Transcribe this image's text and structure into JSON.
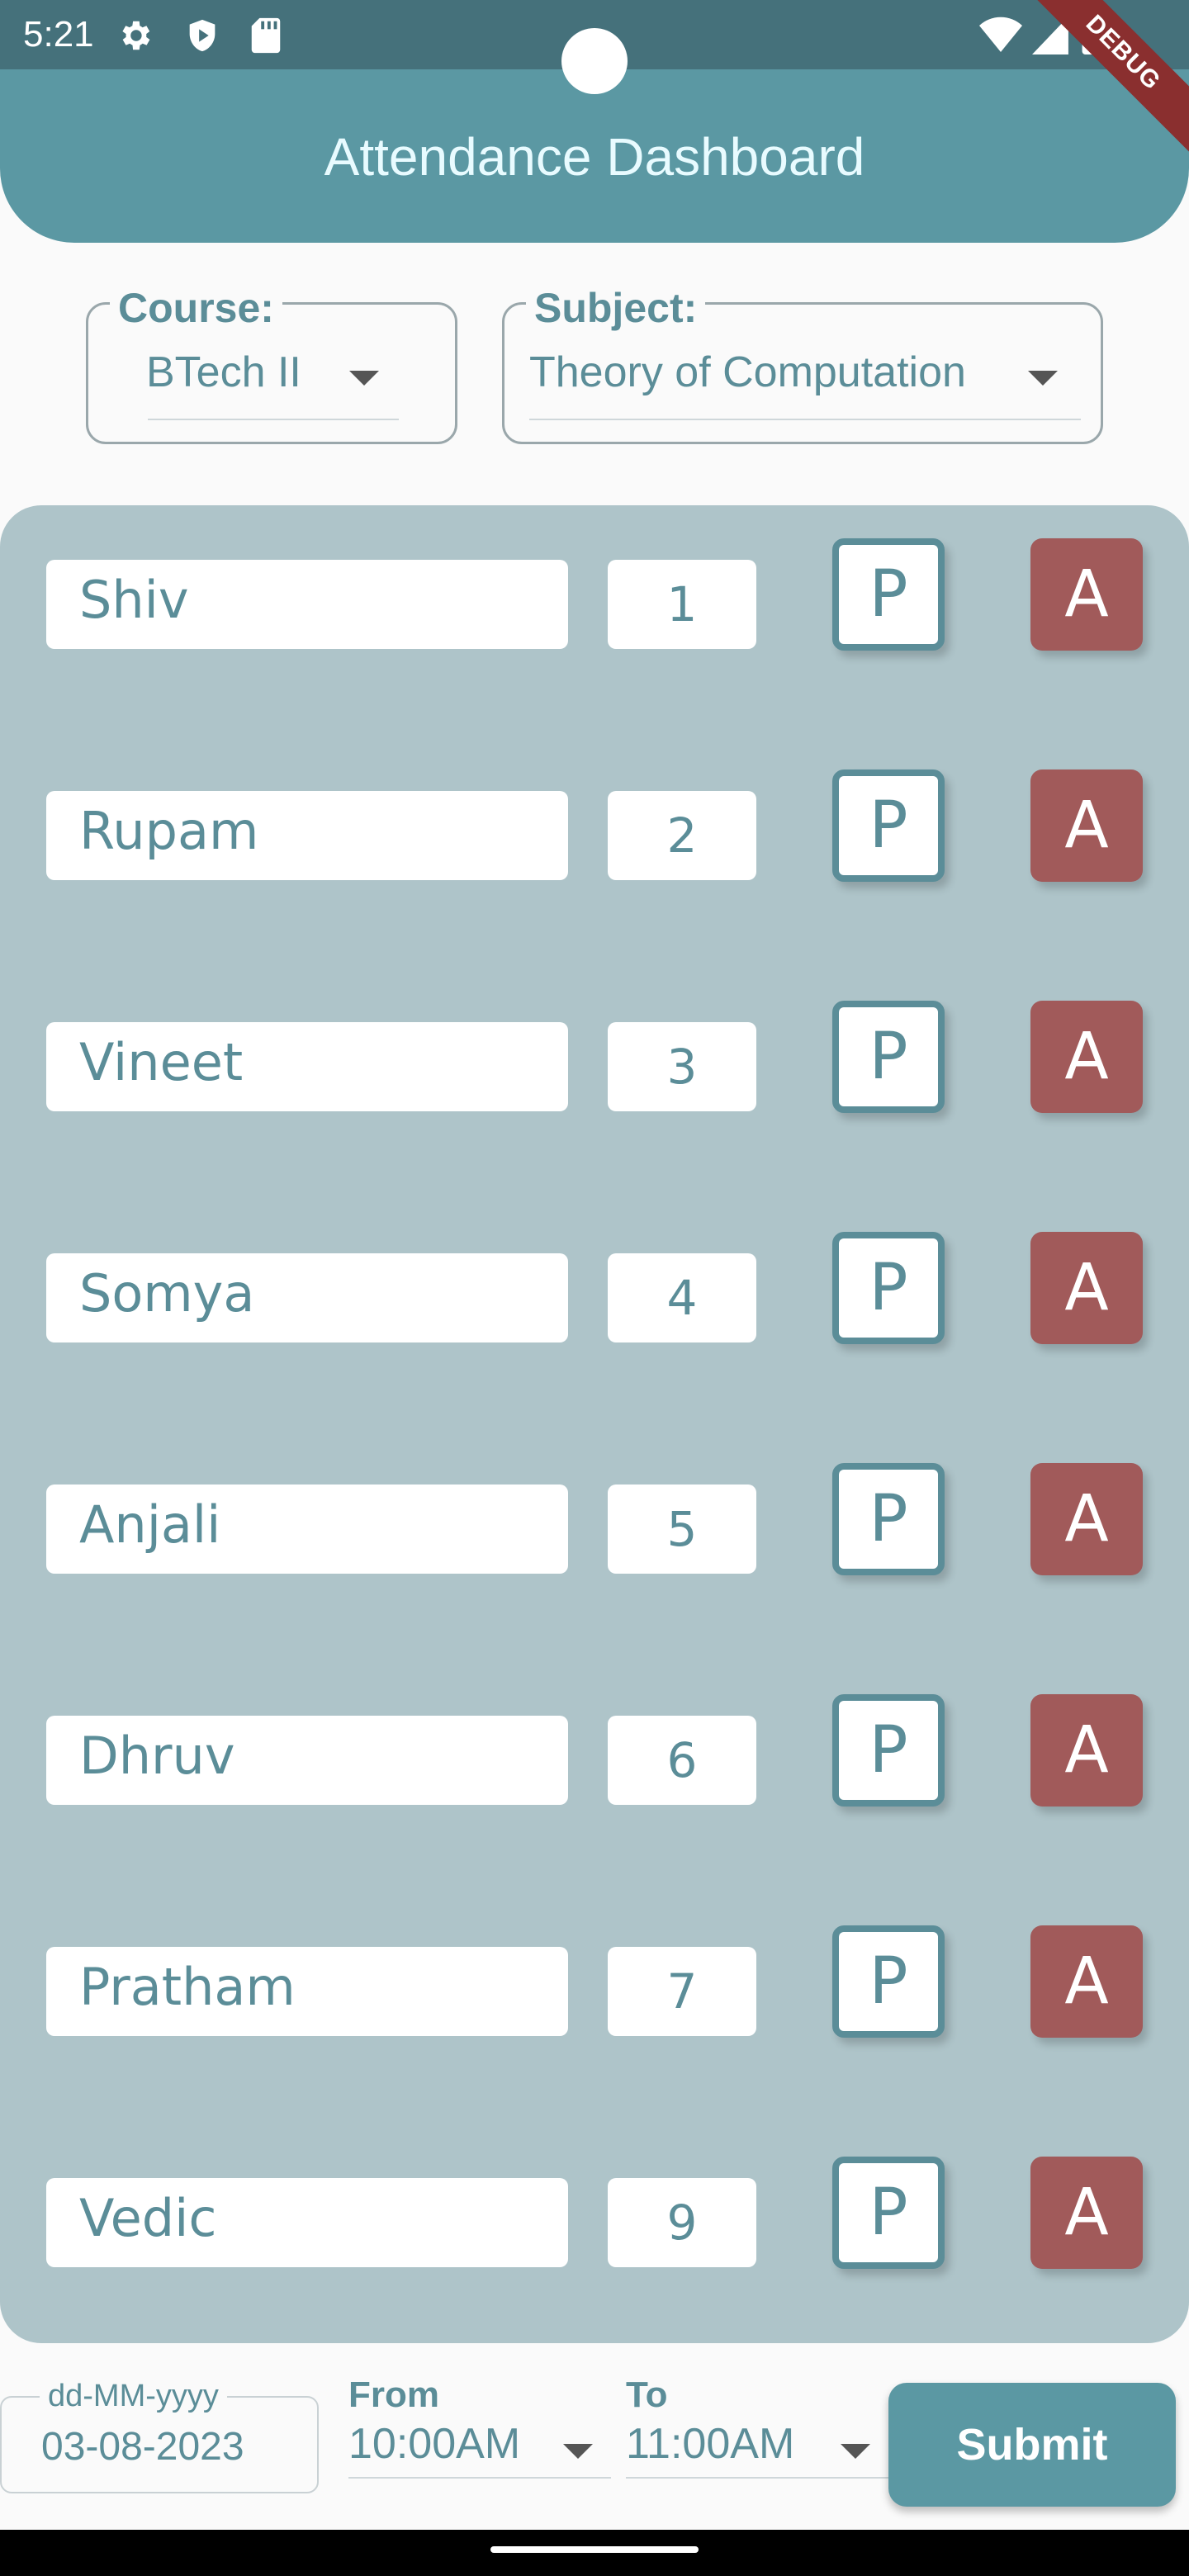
{
  "status_bar": {
    "time": "5:21",
    "icons": [
      "settings-icon",
      "shield-play-icon",
      "sd-card-icon",
      "wifi-icon",
      "signal-icon",
      "battery-icon"
    ]
  },
  "debug_banner": "DEBUG",
  "app_bar": {
    "title": "Attendance Dashboard"
  },
  "filters": {
    "course": {
      "label": "Course:",
      "value": "BTech II"
    },
    "subject": {
      "label": "Subject:",
      "value": "Theory of Computation"
    }
  },
  "students": [
    {
      "name": "Shiv",
      "roll": "1",
      "present_label": "P",
      "absent_label": "A"
    },
    {
      "name": "Rupam",
      "roll": "2",
      "present_label": "P",
      "absent_label": "A"
    },
    {
      "name": "Vineet",
      "roll": "3",
      "present_label": "P",
      "absent_label": "A"
    },
    {
      "name": "Somya",
      "roll": "4",
      "present_label": "P",
      "absent_label": "A"
    },
    {
      "name": "Anjali",
      "roll": "5",
      "present_label": "P",
      "absent_label": "A"
    },
    {
      "name": "Dhruv",
      "roll": "6",
      "present_label": "P",
      "absent_label": "A"
    },
    {
      "name": "Pratham",
      "roll": "7",
      "present_label": "P",
      "absent_label": "A"
    },
    {
      "name": "Vedic",
      "roll": "9",
      "present_label": "P",
      "absent_label": "A"
    }
  ],
  "bottom": {
    "date": {
      "label": "dd-MM-yyyy",
      "value": "03-08-2023"
    },
    "from": {
      "label": "From",
      "value": "10:00AM"
    },
    "to": {
      "label": "To",
      "value": "11:00AM"
    },
    "submit_label": "Submit"
  },
  "colors": {
    "accent": "#5b98a3",
    "status_bar": "#45717b",
    "panel": "#aec4c9",
    "absent": "#a15a5a",
    "text_accent": "#5b8d98"
  }
}
